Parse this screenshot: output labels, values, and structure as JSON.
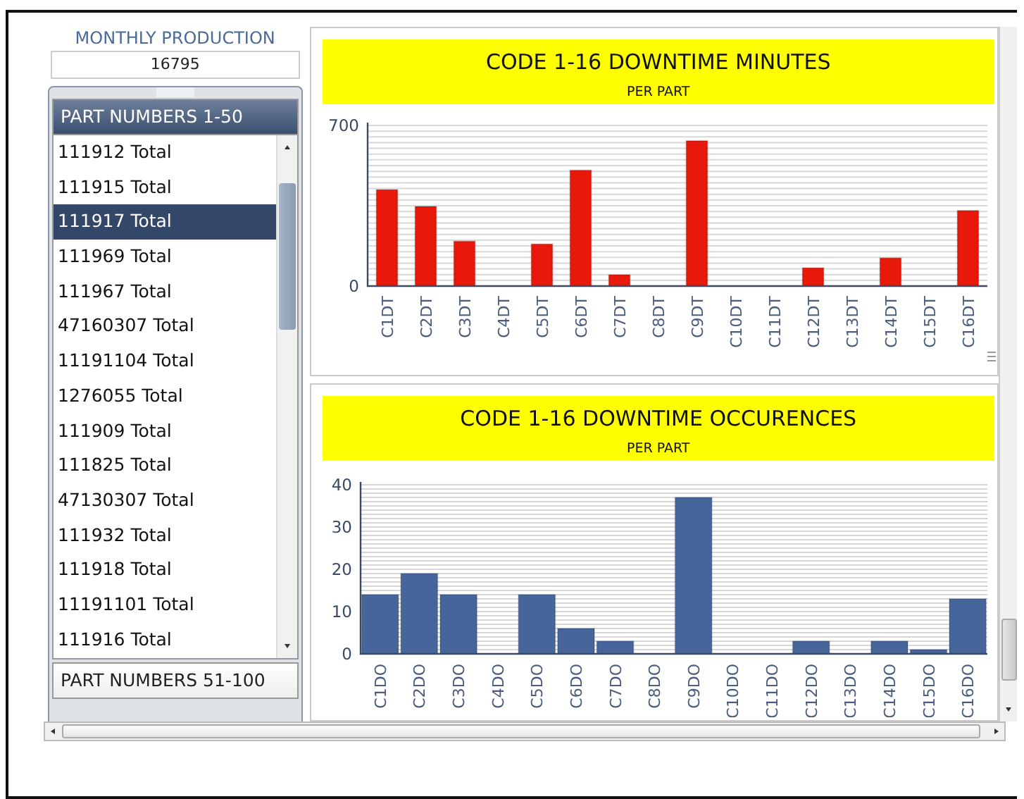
{
  "production": {
    "label": "MONTHLY PRODUCTION",
    "value": "16795"
  },
  "part_groups": [
    {
      "label": "PART NUMBERS 1-50",
      "expanded": true,
      "items": [
        {
          "label": "111912 Total",
          "selected": false
        },
        {
          "label": "111915 Total",
          "selected": false
        },
        {
          "label": "111917 Total",
          "selected": true
        },
        {
          "label": "111969 Total",
          "selected": false
        },
        {
          "label": "111967 Total",
          "selected": false
        },
        {
          "label": "47160307 Total",
          "selected": false
        },
        {
          "label": "11191104 Total",
          "selected": false
        },
        {
          "label": "1276055 Total",
          "selected": false
        },
        {
          "label": "111909 Total",
          "selected": false
        },
        {
          "label": "111825 Total",
          "selected": false
        },
        {
          "label": "47130307 Total",
          "selected": false
        },
        {
          "label": "111932 Total",
          "selected": false
        },
        {
          "label": "111918 Total",
          "selected": false
        },
        {
          "label": "11191101 Total",
          "selected": false
        },
        {
          "label": "111916 Total",
          "selected": false
        }
      ]
    },
    {
      "label": "PART NUMBERS 51-100",
      "expanded": false
    }
  ],
  "charts": [
    {
      "title": "CODE 1-16 DOWNTIME MINUTES",
      "subtitle": "PER PART",
      "chart_data": {
        "type": "bar",
        "categories": [
          "C1DT",
          "C2DT",
          "C3DT",
          "C4DT",
          "C5DT",
          "C6DT",
          "C7DT",
          "C8DT",
          "C9DT",
          "C10DT",
          "C11DT",
          "C12DT",
          "C13DT",
          "C14DT",
          "C15DT",
          "C16DT"
        ],
        "ylim": [
          0,
          700
        ],
        "yticks": [
          0,
          700
        ],
        "grid": true,
        "series": [
          {
            "color": "#e8180a",
            "values": [
              420,
              347,
              195,
              0,
              183,
              505,
              49,
              0,
              633,
              0,
              0,
              79,
              0,
              122,
              0,
              329
            ]
          }
        ]
      }
    },
    {
      "title": "CODE 1-16 DOWNTIME OCCURENCES",
      "subtitle": "PER PART",
      "chart_data": {
        "type": "bar",
        "categories": [
          "C1DO",
          "C2DO",
          "C3DO",
          "C4DO",
          "C5DO",
          "C6DO",
          "C7DO",
          "C8DO",
          "C9DO",
          "C10DO",
          "C11DO",
          "C12DO",
          "C13DO",
          "C14DO",
          "C15DO",
          "C16DO"
        ],
        "ylim": [
          0,
          40
        ],
        "yticks": [
          0,
          10,
          20,
          30,
          40
        ],
        "grid": true,
        "series": [
          {
            "color": "#46659a",
            "values": [
              14,
              19,
              14,
              0,
              14,
              6,
              3,
              0,
              37,
              0,
              0,
              3,
              0,
              3,
              1,
              13
            ]
          }
        ]
      }
    }
  ]
}
